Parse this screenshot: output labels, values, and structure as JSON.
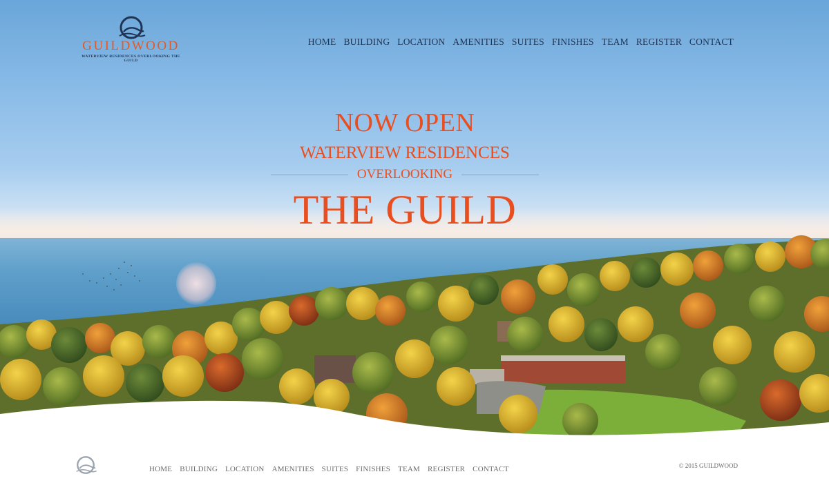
{
  "brand": {
    "name": "GUILDWOOD",
    "tagline": "WATERVIEW RESIDENCES OVERLOOKING THE GUILD",
    "accent_color": "#e45a24",
    "navy_color": "#1f3354"
  },
  "nav": [
    {
      "label": "HOME"
    },
    {
      "label": "BUILDING"
    },
    {
      "label": "LOCATION"
    },
    {
      "label": "AMENITIES"
    },
    {
      "label": "SUITES"
    },
    {
      "label": "FINISHES"
    },
    {
      "label": "TEAM"
    },
    {
      "label": "REGISTER"
    },
    {
      "label": "CONTACT"
    }
  ],
  "hero": {
    "line1": "NOW OPEN",
    "line2": "WATERVIEW RESIDENCES",
    "line3": "OVERLOOKING",
    "line4": "THE GUILD"
  },
  "footer": {
    "nav": [
      {
        "label": "HOME"
      },
      {
        "label": "BUILDING"
      },
      {
        "label": "LOCATION"
      },
      {
        "label": "AMENITIES"
      },
      {
        "label": "SUITES"
      },
      {
        "label": "FINISHES"
      },
      {
        "label": "TEAM"
      },
      {
        "label": "REGISTER"
      },
      {
        "label": "CONTACT"
      }
    ],
    "copyright": "© 2015 GUILDWOOD"
  }
}
